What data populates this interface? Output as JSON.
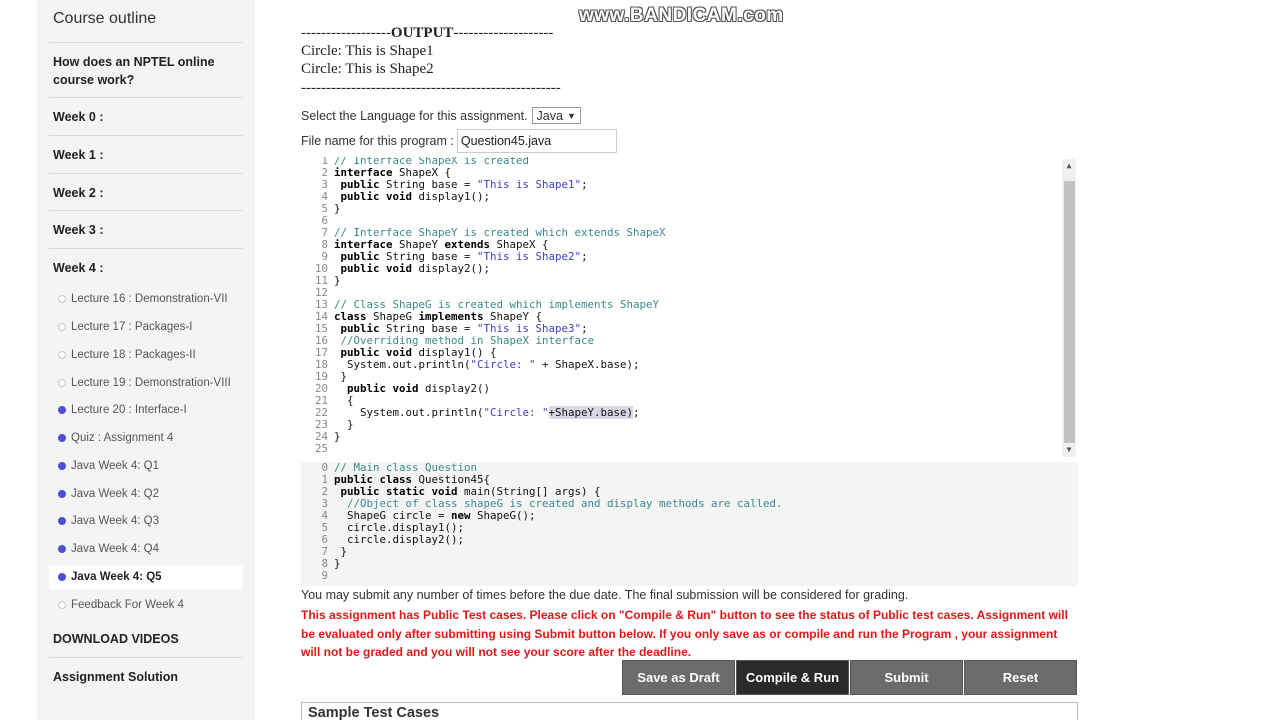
{
  "sidebar": {
    "title": "Course outline",
    "headings": [
      "How does an NPTEL online course work?",
      "Week 0 :",
      "Week 1 :",
      "Week 2 :",
      "Week 3 :",
      "Week 4 :"
    ],
    "items": [
      {
        "label": "Lecture 16 : Demonstration-VII",
        "status": "not-done"
      },
      {
        "label": "Lecture 17 : Packages-I",
        "status": "not-done"
      },
      {
        "label": "Lecture 18 : Packages-II",
        "status": "not-done"
      },
      {
        "label": "Lecture 19 : Demonstration-VIII",
        "status": "not-done"
      },
      {
        "label": "Lecture 20 : Interface-I",
        "status": "done"
      },
      {
        "label": "Quiz : Assignment 4",
        "status": "done"
      },
      {
        "label": "Java Week 4: Q1",
        "status": "done"
      },
      {
        "label": "Java Week 4: Q2",
        "status": "done"
      },
      {
        "label": "Java Week 4: Q3",
        "status": "done"
      },
      {
        "label": "Java Week 4: Q4",
        "status": "done"
      },
      {
        "label": "Java Week 4: Q5",
        "status": "done",
        "active": true
      },
      {
        "label": "Feedback For Week 4",
        "status": "not-done"
      }
    ],
    "footer_links": [
      "DOWNLOAD VIDEOS",
      "Assignment Solution"
    ]
  },
  "watermark": "www.BANDICAM.com",
  "output_block": {
    "header_prefix": "------------------",
    "header_label": "OUTPUT",
    "header_suffix": "--------------------",
    "lines": [
      "Circle: This is Shape1",
      "Circle: This is Shape2"
    ],
    "footer": "----------------------------------------------------"
  },
  "language": {
    "label": "Select the Language for this assignment.",
    "value": "Java"
  },
  "file": {
    "label": "File name for this program :",
    "value": "Question45.java"
  },
  "editor_top_numbers": "1\n2\n3\n4\n5\n6\n7\n8\n9\n10\n11\n12\n13\n14\n15\n16\n17\n18\n19\n20\n21\n22\n23\n24\n25",
  "editor_bottom_numbers": "0\n1\n2\n3\n4\n5\n6\n7\n8\n9",
  "submission_note": "You may submit any number of times before the due date. The final submission will be considered for grading.",
  "warning": "This assignment has Public Test cases. Please click on \"Compile & Run\" button to see the status of Public test cases. Assignment will be evaluated only after submitting using Submit button below. If you only save as or compile and run the Program , your assignment will not be graded and you will not see your score after the deadline.",
  "buttons": {
    "save_draft": "Save as Draft",
    "compile_run": "Compile & Run",
    "submit": "Submit",
    "reset": "Reset"
  },
  "sample_title": "Sample Test Cases"
}
